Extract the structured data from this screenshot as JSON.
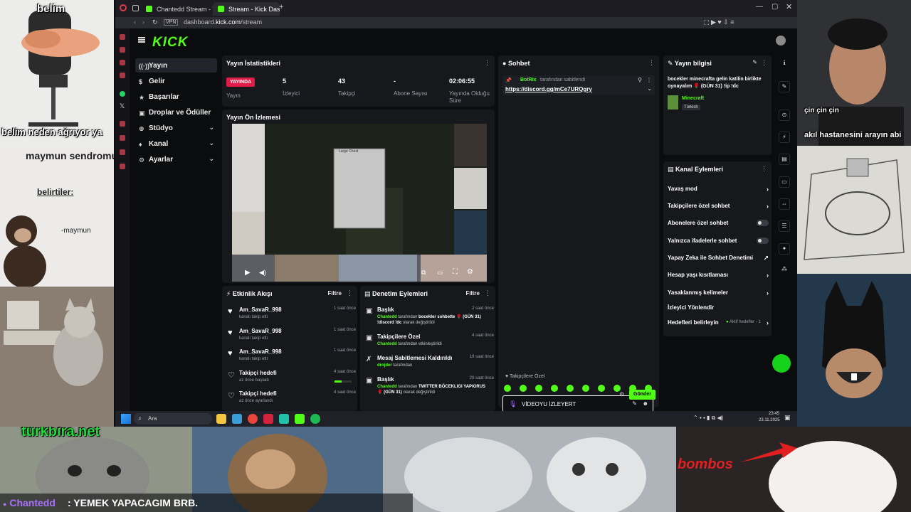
{
  "overlays": {
    "belim": "belim",
    "belim_question": "belim neden ağrıyor ya",
    "maymun_title": "maymun sendromu",
    "belirtiler": "belirtiler:",
    "maymun_sig": "-maymun",
    "cin_cin": "çin çin çin",
    "akil": "akıl hastanesini arayın abi",
    "turkbira": "türkbira.net",
    "bombos": "bombos",
    "ticker_user": "Chantedd",
    "ticker_msg": ": YEMEK YAPACAGIM BRB."
  },
  "browser": {
    "tabs": [
      {
        "label": "Chantedd Stream - Watch"
      },
      {
        "label": "Stream - Kick Dashboard"
      }
    ],
    "url_host": "dashboard.",
    "url_domain": "kick.com",
    "url_path": "/stream"
  },
  "kick": {
    "logo": "KICK",
    "nav": [
      {
        "label": "Yayın",
        "icon": "((·))"
      },
      {
        "label": "Gelir",
        "icon": "$"
      },
      {
        "label": "Başarılar",
        "icon": "★"
      },
      {
        "label": "Droplar ve Ödüller",
        "icon": "▣"
      },
      {
        "label": "Stüdyo",
        "icon": "⊕"
      },
      {
        "label": "Kanal",
        "icon": "♦"
      },
      {
        "label": "Ayarlar",
        "icon": "⚙"
      }
    ],
    "stats": {
      "title": "Yayın İstatistikleri",
      "live_badge": "YAYINDA",
      "live_label": "Yayın",
      "viewers_value": "5",
      "viewers_label": "İzleyici",
      "followers_value": "43",
      "followers_label": "Takipçi",
      "subs_value": "-",
      "subs_label": "Abone Sayısı",
      "uptime_value": "02:06:55",
      "uptime_label": "Yayında Olduğu Süre"
    },
    "preview": {
      "title": "Yayın Ön İzlemesi",
      "inventory_title": "Large Chest"
    },
    "activity": {
      "title": "Etkinlik Akışı",
      "filter": "Filtre",
      "rows": [
        {
          "name": "Am_SavaR_998",
          "sub": "kanalı takip etti",
          "time": "1 saat önce"
        },
        {
          "name": "Am_SavaR_998",
          "sub": "kanalı takip etti",
          "time": "1 saat önce"
        },
        {
          "name": "Am_SavaR_998",
          "sub": "kanalı takip etti",
          "time": "1 saat önce"
        },
        {
          "name": "Takipçi hedefi",
          "sub": "az önce başladı",
          "time": "4 saat önce"
        },
        {
          "name": "Takipçi hedefi",
          "sub": "az önce ayarlandı",
          "time": "4 saat önce"
        }
      ]
    },
    "moderation": {
      "title": "Denetim Eylemleri",
      "filter": "Filtre",
      "rows": [
        {
          "name": "Başlık",
          "time": "2 saat önce",
          "user": "Chantedd",
          "mid": " tarafından ",
          "bold": "bocekler sohbette 🌹 (GÜN 31) !discord !dc",
          "end": " olarak değiştirildi"
        },
        {
          "name": "Takipçilere Özel",
          "time": "4 saat önce",
          "user": "Chantedd",
          "mid": " tarafından etkinleştirildi",
          "bold": "",
          "end": ""
        },
        {
          "name": "Mesaj Sabitlemesi Kaldırıldı",
          "time": "19 saat önce",
          "user": "drojder",
          "mid": " tarafından",
          "bold": "",
          "end": ""
        },
        {
          "name": "Başlık",
          "time": "20 saat önce",
          "user": "Chantedd",
          "mid": " tarafından ",
          "bold": "TWITTER BÖCEKLIGI YAPIORUS 🌹 (GÜN 31)",
          "end": " olarak değiştirildi"
        }
      ]
    },
    "chat": {
      "title": "Sohbet",
      "pinned_by_user": "BotRix",
      "pinned_by_text": "tarafından sabitlendi",
      "pinned_link": "https://discord.gg/mCe7URQgry",
      "mode_label": "Takipçilere Özel",
      "input_value": "VİDEOYU İZLEYERT",
      "send": "Gönder"
    },
    "stream_info": {
      "title": "Yayın bilgisi",
      "stream_title": "bocekler minecrafta gelin katilin birlikte oynayalım 🌹 (GÜN 31) !ip !dc",
      "category": "Minecraft",
      "language": "Türkish"
    },
    "channel_actions": {
      "title": "Kanal Eylemleri",
      "items": [
        {
          "label": "Yavaş mod",
          "kind": "chev"
        },
        {
          "label": "Takipçilere özel sohbet",
          "kind": "chev"
        },
        {
          "label": "Abonelere özel sohbet",
          "kind": "toggle"
        },
        {
          "label": "Yalnızca ifadelerle sohbet",
          "kind": "toggle"
        },
        {
          "label": "Yapay Zeka ile Sohbet Denetimi",
          "kind": "ext"
        },
        {
          "label": "Hesap yaşı kısıtlaması",
          "kind": "chev"
        },
        {
          "label": "Yasaklanmış kelimeler",
          "kind": "chev"
        },
        {
          "label": "İzleyici Yönlendir",
          "kind": "none"
        },
        {
          "label": "Hedefleri belirleyin",
          "kind": "chev"
        }
      ],
      "goals_status": "Aktif hedefler - 1"
    }
  },
  "taskbar": {
    "search": "Ara",
    "time": "23:45",
    "date": "23.11.2025"
  },
  "colors": {
    "kick_green": "#53fc18",
    "live_red": "#e21c48",
    "ticker_purple": "#a970ff"
  }
}
